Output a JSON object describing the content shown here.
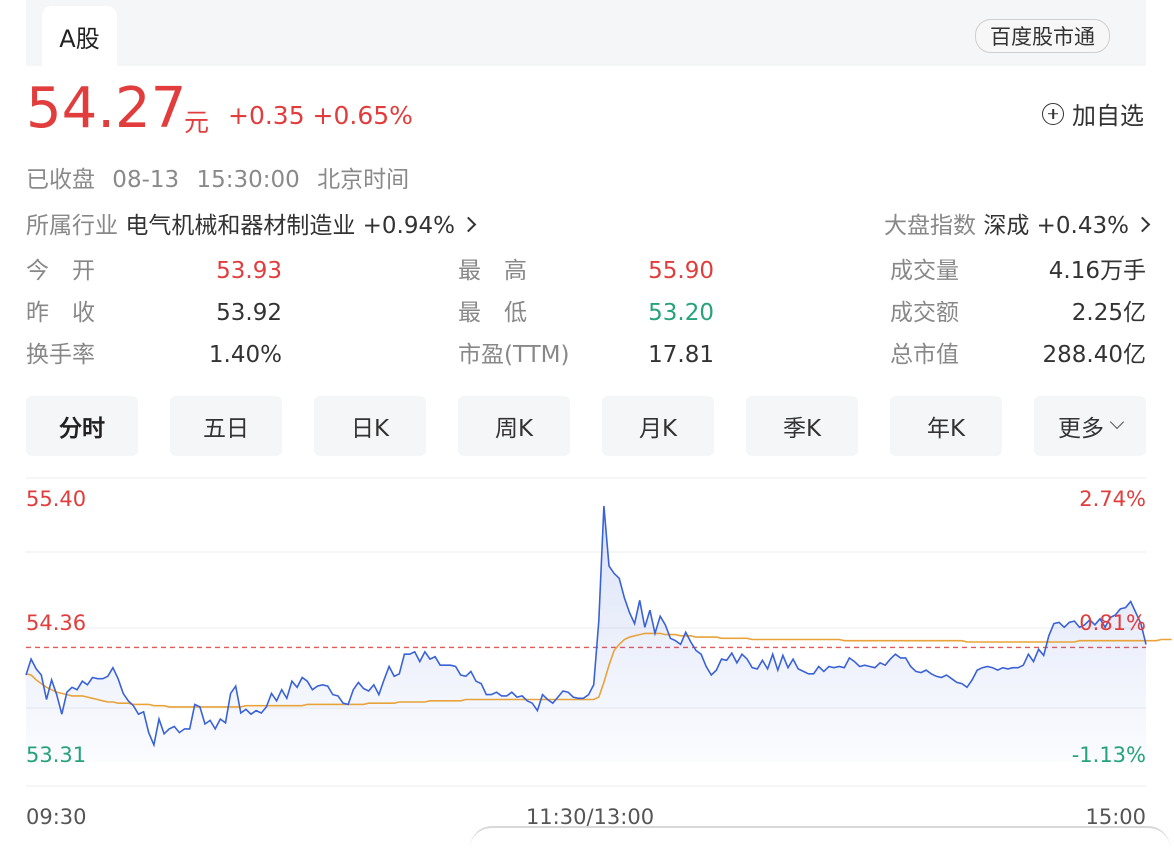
{
  "tabs": {
    "active": "A股",
    "app_link": "百度股市通"
  },
  "quote": {
    "price": "54.27",
    "currency": "元",
    "change": "+0.35 +0.65%",
    "watch_label": "加自选"
  },
  "status": {
    "text": "已收盘 08-13 15:30:00 北京时间"
  },
  "industry": {
    "label": "所属行业",
    "name": "电气机械和器材制造业",
    "change": "+0.94%"
  },
  "index": {
    "label": "大盘指数",
    "name": "深成",
    "change": "+0.43%"
  },
  "stats": {
    "open_label": "今　开",
    "open": "53.93",
    "prev_label": "昨　收",
    "prev": "53.92",
    "turnover_label": "换手率",
    "turnover": "1.40%",
    "high_label": "最　高",
    "high": "55.90",
    "low_label": "最　低",
    "low": "53.20",
    "pe_label": "市盈(TTM)",
    "pe": "17.81",
    "volume_label": "成交量",
    "volume": "4.16万手",
    "amount_label": "成交额",
    "amount": "2.25亿",
    "mcap_label": "总市值",
    "mcap": "288.40亿"
  },
  "periods": [
    "分时",
    "五日",
    "日K",
    "周K",
    "月K",
    "季K",
    "年K",
    "更多"
  ],
  "colors": {
    "up": "#e13d3d",
    "down": "#26a37a",
    "price_line": "#3a62d7",
    "avg_line": "#e8a33a"
  },
  "chart_data": {
    "type": "line",
    "title": "",
    "y_left_ticks": [
      "55.40",
      "54.36",
      "53.31"
    ],
    "y_right_ticks": [
      "2.74%",
      "0.81%",
      "-1.13%"
    ],
    "x_tick_labels": [
      "09:30",
      "11:30/13:00",
      "15:00"
    ],
    "ylim": [
      53.31,
      55.4
    ],
    "reference_price": 54.36,
    "series": [
      {
        "role": "price",
        "values": [
          54.02,
          54.15,
          54.07,
          54.02,
          53.82,
          53.98,
          53.86,
          53.7,
          53.88,
          53.92,
          53.9,
          53.97,
          53.94,
          54.0,
          53.99,
          53.99,
          54.01,
          54.08,
          53.99,
          53.87,
          53.81,
          53.77,
          53.7,
          53.72,
          53.55,
          53.45,
          53.66,
          53.54,
          53.58,
          53.6,
          53.55,
          53.58,
          53.58,
          53.78,
          53.76,
          53.62,
          53.65,
          53.58,
          53.66,
          53.63,
          53.87,
          53.93,
          53.71,
          53.74,
          53.7,
          53.73,
          53.71,
          53.76,
          53.87,
          53.81,
          53.9,
          53.83,
          53.97,
          53.92,
          54.0,
          53.97,
          53.9,
          53.93,
          53.94,
          53.93,
          53.86,
          53.85,
          53.79,
          53.78,
          53.9,
          53.96,
          53.91,
          53.89,
          53.94,
          53.86,
          53.98,
          54.09,
          54.01,
          54.03,
          54.19,
          54.19,
          54.21,
          54.13,
          54.21,
          54.15,
          54.17,
          54.1,
          54.1,
          54.1,
          54.09,
          54.02,
          54.01,
          54.05,
          53.97,
          53.95,
          53.86,
          53.86,
          53.88,
          53.85,
          53.85,
          53.88,
          53.84,
          53.85,
          53.81,
          53.79,
          53.73,
          53.86,
          53.82,
          53.79,
          53.84,
          53.89,
          53.88,
          53.84,
          53.83,
          53.83,
          53.86,
          53.94,
          54.46,
          55.4,
          54.91,
          54.85,
          54.81,
          54.65,
          54.53,
          54.44,
          54.63,
          54.41,
          54.55,
          54.36,
          54.5,
          54.43,
          54.32,
          54.3,
          54.27,
          54.37,
          54.29,
          54.22,
          54.19,
          54.09,
          54.02,
          54.06,
          54.15,
          54.14,
          54.2,
          54.12,
          54.19,
          54.15,
          54.08,
          54.07,
          54.14,
          54.07,
          54.19,
          54.06,
          54.18,
          54.08,
          54.15,
          54.07,
          54.05,
          54.03,
          54.03,
          54.09,
          54.05,
          54.09,
          54.08,
          54.09,
          54.08,
          54.16,
          54.13,
          54.09,
          54.1,
          54.09,
          54.08,
          54.12,
          54.1,
          54.15,
          54.19,
          54.16,
          54.16,
          54.09,
          54.05,
          54.04,
          54.06,
          54.03,
          54.01,
          54.0,
          54.02,
          53.99,
          53.96,
          53.95,
          53.92,
          53.98,
          54.06,
          54.08,
          54.09,
          54.08,
          54.06,
          54.08,
          54.07,
          54.08,
          54.08,
          54.1,
          54.19,
          54.13,
          54.23,
          54.18,
          54.34,
          54.44,
          54.45,
          54.41,
          54.45,
          54.46,
          54.41,
          54.43,
          54.47,
          54.43,
          54.48,
          54.41,
          54.49,
          54.51,
          54.56,
          54.57,
          54.62,
          54.53,
          54.44,
          54.27
        ],
        "min_index_note": null
      },
      {
        "role": "average",
        "values": [
          54.03,
          54.02,
          53.98,
          53.95,
          53.92,
          53.9,
          53.88,
          53.87,
          53.86,
          53.85,
          53.85,
          53.85,
          53.84,
          53.83,
          53.82,
          53.81,
          53.8,
          53.8,
          53.79,
          53.79,
          53.79,
          53.78,
          53.78,
          53.78,
          53.78,
          53.77,
          53.77,
          53.77,
          53.76,
          53.76,
          53.76,
          53.76,
          53.76,
          53.76,
          53.76,
          53.76,
          53.76,
          53.76,
          53.76,
          53.76,
          53.76,
          53.76,
          53.76,
          53.77,
          53.77,
          53.77,
          53.77,
          53.77,
          53.77,
          53.77,
          53.77,
          53.77,
          53.77,
          53.77,
          53.77,
          53.78,
          53.78,
          53.78,
          53.78,
          53.78,
          53.78,
          53.78,
          53.78,
          53.78,
          53.78,
          53.78,
          53.78,
          53.79,
          53.79,
          53.79,
          53.79,
          53.79,
          53.79,
          53.8,
          53.8,
          53.8,
          53.8,
          53.8,
          53.8,
          53.81,
          53.81,
          53.81,
          53.81,
          53.81,
          53.81,
          53.81,
          53.82,
          53.82,
          53.82,
          53.82,
          53.82,
          53.82,
          53.82,
          53.82,
          53.82,
          53.82,
          53.82,
          53.82,
          53.82,
          53.82,
          53.82,
          53.82,
          53.82,
          53.82,
          53.82,
          53.82,
          53.82,
          53.82,
          53.82,
          53.82,
          53.82,
          53.82,
          53.84,
          53.96,
          54.1,
          54.22,
          54.27,
          54.31,
          54.33,
          54.34,
          54.35,
          54.36,
          54.36,
          54.36,
          54.36,
          54.35,
          54.35,
          54.35,
          54.34,
          54.34,
          54.34,
          54.33,
          54.33,
          54.33,
          54.33,
          54.33,
          54.32,
          54.32,
          54.32,
          54.32,
          54.32,
          54.32,
          54.31,
          54.31,
          54.31,
          54.31,
          54.31,
          54.31,
          54.31,
          54.31,
          54.31,
          54.31,
          54.31,
          54.31,
          54.31,
          54.31,
          54.31,
          54.31,
          54.31,
          54.31,
          54.3,
          54.3,
          54.3,
          54.3,
          54.3,
          54.3,
          54.3,
          54.3,
          54.3,
          54.3,
          54.3,
          54.3,
          54.3,
          54.3,
          54.3,
          54.3,
          54.3,
          54.3,
          54.3,
          54.3,
          54.3,
          54.3,
          54.3,
          54.3,
          54.29,
          54.29,
          54.29,
          54.29,
          54.29,
          54.29,
          54.29,
          54.29,
          54.29,
          54.29,
          54.29,
          54.29,
          54.29,
          54.29,
          54.29,
          54.29,
          54.29,
          54.29,
          54.29,
          54.29,
          54.29,
          54.29,
          54.3,
          54.3,
          54.3,
          54.3,
          54.3,
          54.3,
          54.3,
          54.3,
          54.3,
          54.3,
          54.3,
          54.3,
          54.3,
          54.3,
          54.3,
          54.3,
          54.31,
          54.31,
          54.31
        ]
      }
    ]
  }
}
